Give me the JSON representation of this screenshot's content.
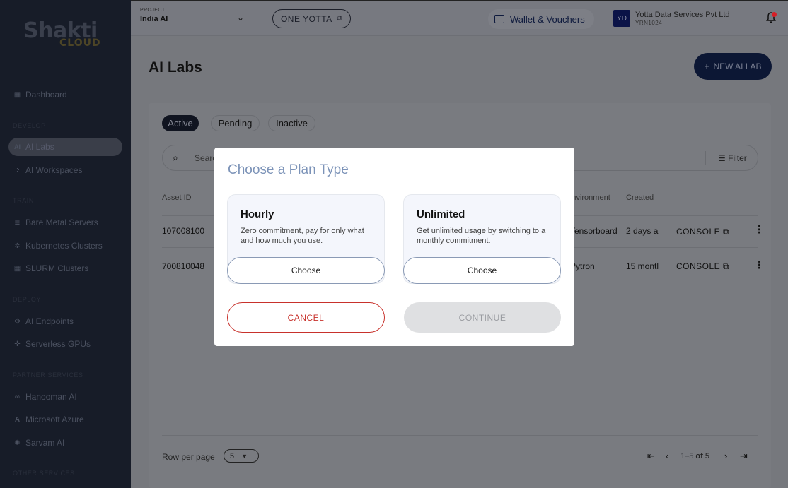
{
  "brand": {
    "name": "Shakti",
    "sub": "CLOUD"
  },
  "sidebar": {
    "items": [
      {
        "label": "Dashboard",
        "icon": "grid-icon"
      },
      {
        "label": "AI Labs",
        "icon": "ai-icon",
        "active": true
      },
      {
        "label": "AI Workspaces",
        "icon": "nodes-icon"
      },
      {
        "label": "Bare Metal Servers",
        "icon": "server-icon"
      },
      {
        "label": "Kubernetes Clusters",
        "icon": "k8s-icon"
      },
      {
        "label": "SLURM Clusters",
        "icon": "slurm-icon"
      },
      {
        "label": "AI Endpoints",
        "icon": "endpoint-icon"
      },
      {
        "label": "Serverless GPUs",
        "icon": "plus-icon"
      },
      {
        "label": "Hanooman AI",
        "icon": "infinity-icon"
      },
      {
        "label": "Microsoft Azure",
        "icon": "azure-icon"
      },
      {
        "label": "Sarvam AI",
        "icon": "sarvam-icon"
      }
    ],
    "sections": [
      "DEVELOP",
      "TRAIN",
      "DEPLOY",
      "PARTNER SERVICES",
      "OTHER SERVICES"
    ]
  },
  "topbar": {
    "project_label": "PROJECT",
    "project_value": "India AI",
    "one_yotta": "ONE YOTTA",
    "wallet": "Wallet & Vouchers",
    "org_initials": "YD",
    "org_name": "Yotta Data Services Pvt Ltd",
    "org_id": "YRN1024"
  },
  "page": {
    "title": "AI Labs",
    "new_button": "NEW AI LAB",
    "tabs": [
      "Active",
      "Pending",
      "Inactive"
    ],
    "search_placeholder": "Search",
    "filter": "Filter",
    "columns": {
      "asset_id": "Asset ID",
      "environment": "Environment",
      "created": "Created"
    },
    "rows": [
      {
        "asset_id": "107008100",
        "environment": "Tensorboard",
        "created": "2 days a",
        "action": "CONSOLE"
      },
      {
        "asset_id": "700810048",
        "environment": "Pytron",
        "created": "15 montl",
        "action": "CONSOLE"
      }
    ],
    "rows_per_page_label": "Row per page",
    "rows_per_page": "5",
    "pagination": {
      "range": "1–5",
      "of": "of",
      "total": "5"
    }
  },
  "modal": {
    "title": "Choose a Plan Type",
    "plans": [
      {
        "name": "Hourly",
        "desc": "Zero commitment, pay for only what and how much you use.",
        "button": "Choose"
      },
      {
        "name": "Unlimited",
        "desc": "Get unlimited usage by switching to a monthly commitment.",
        "button": "Choose"
      }
    ],
    "cancel": "CANCEL",
    "continue": "CONTINUE"
  }
}
